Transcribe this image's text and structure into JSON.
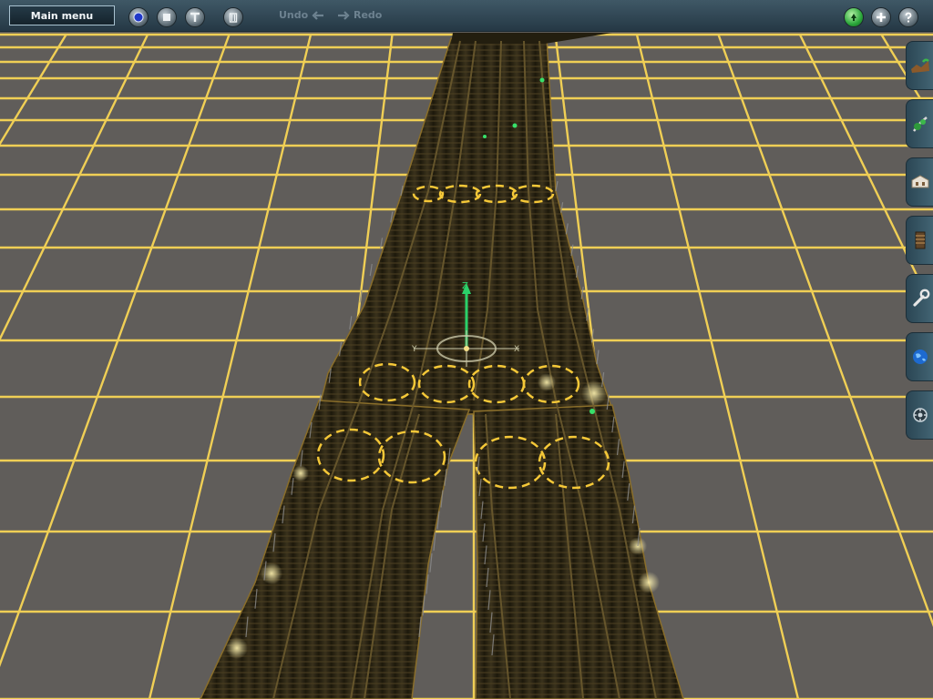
{
  "toolbar": {
    "main_menu_label": "Main menu",
    "undo_label": "Undo",
    "redo_label": "Redo",
    "left_buttons": [
      {
        "name": "camera-view-button",
        "icon": "sphere-icon"
      },
      {
        "name": "stop-button",
        "icon": "square-icon"
      },
      {
        "name": "tools-button",
        "icon": "t-shape-icon"
      },
      {
        "name": "delete-button",
        "icon": "trash-icon"
      }
    ],
    "right_buttons": [
      {
        "name": "status-button",
        "icon": "green-light-icon"
      },
      {
        "name": "add-button",
        "icon": "plus-icon"
      },
      {
        "name": "help-button",
        "icon": "question-icon"
      }
    ]
  },
  "side_tabs": [
    {
      "name": "terrain-tab",
      "icon": "terrain-icon"
    },
    {
      "name": "scenery-tab",
      "icon": "tree-icon"
    },
    {
      "name": "objects-tab",
      "icon": "building-icon"
    },
    {
      "name": "track-tab",
      "icon": "track-icon"
    },
    {
      "name": "tools-tab",
      "icon": "wrench-icon"
    },
    {
      "name": "world-tab",
      "icon": "globe-icon"
    },
    {
      "name": "settings-tab",
      "icon": "gear-icon"
    }
  ],
  "gizmo_labels": {
    "z": "Z",
    "x": "X",
    "y": "Y"
  },
  "colors": {
    "grid_line": "#f0cf55",
    "ground": "#5f5c59",
    "track_bed": "#2b2514",
    "track_edge": "#8a6e2a",
    "spline_circle": "#f5c838",
    "toolbar": "#2f4653",
    "accent_green": "#2aa63a"
  }
}
